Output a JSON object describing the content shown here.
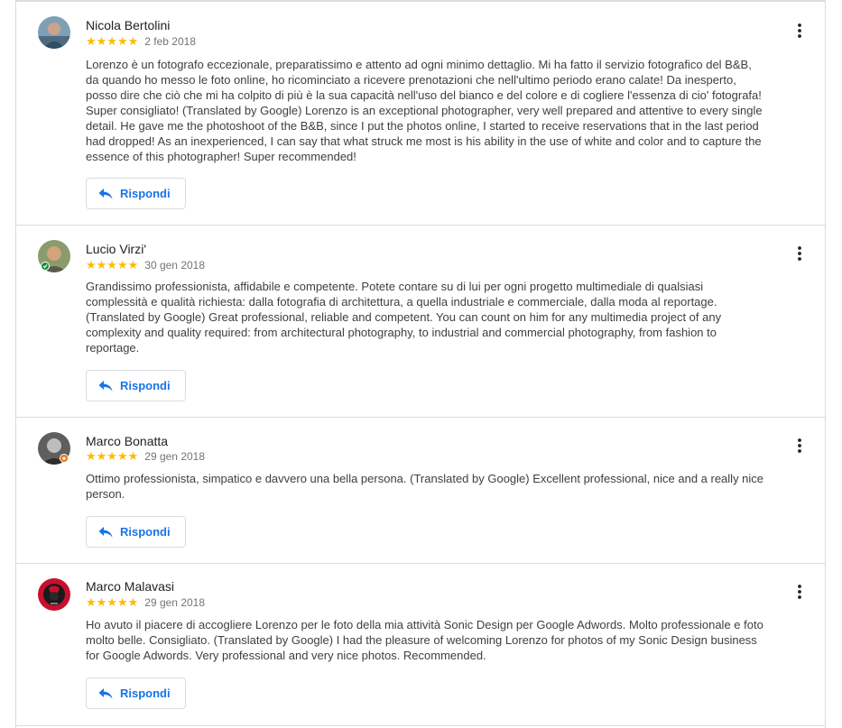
{
  "reviews": [
    {
      "author": "Nicola Bertolini",
      "stars": "★★★★★",
      "date": "2 feb 2018",
      "text": "Lorenzo è un fotografo eccezionale, preparatissimo e attento ad ogni minimo dettaglio. Mi ha fatto il servizio fotografico del B&B, da quando ho messo le foto online, ho ricominciato a ricevere prenotazioni che nell'ultimo periodo erano calate! Da inesperto, posso dire che ciò che mi ha colpito di più è la sua capacità nell'uso del bianco e del colore e di cogliere l'essenza di cio' fotografa! Super consigliato! (Translated by Google) Lorenzo is an exceptional photographer, very well prepared and attentive to every single detail. He gave me the photoshoot of the B&B, since I put the photos online, I started to receive reservations that in the last period had dropped! As an inexperienced, I can say that what struck me most is his ability in the use of white and color and to capture the essence of this photographer! Super recommended!",
      "reply_label": "Rispondi"
    },
    {
      "author": "Lucio Virzi'",
      "stars": "★★★★★",
      "date": "30 gen 2018",
      "text": "Grandissimo professionista, affidabile e competente. Potete contare su di lui per ogni progetto multimediale di qualsiasi complessità e qualità richiesta: dalla fotografia di architettura, a quella industriale e commerciale, dalla moda al reportage. (Translated by Google) Great professional, reliable and competent. You can count on him for any multimedia project of any complexity and quality required: from architectural photography, to industrial and commercial photography, from fashion to reportage.",
      "reply_label": "Rispondi"
    },
    {
      "author": "Marco Bonatta",
      "stars": "★★★★★",
      "date": "29 gen 2018",
      "text": "Ottimo professionista, simpatico e davvero una bella persona. (Translated by Google) Excellent professional, nice and a really nice person.",
      "reply_label": "Rispondi"
    },
    {
      "author": "Marco Malavasi",
      "stars": "★★★★★",
      "date": "29 gen 2018",
      "text": "Ho avuto il piacere di accogliere Lorenzo per le foto della mia attività Sonic Design per Google Adwords. Molto professionale e foto molto belle. Consigliato. (Translated by Google) I had the pleasure of welcoming Lorenzo for photos of my Sonic Design business for Google Adwords. Very professional and very nice photos. Recommended.",
      "reply_label": "Rispondi"
    }
  ],
  "colors": {
    "star": "#fbbc04",
    "accent": "#1a73e8",
    "divider": "#dadce0",
    "text": "#3c4043",
    "meta": "#70757a"
  },
  "icons": {
    "reply": "reply-arrow-icon",
    "more": "more-vert-icon"
  }
}
